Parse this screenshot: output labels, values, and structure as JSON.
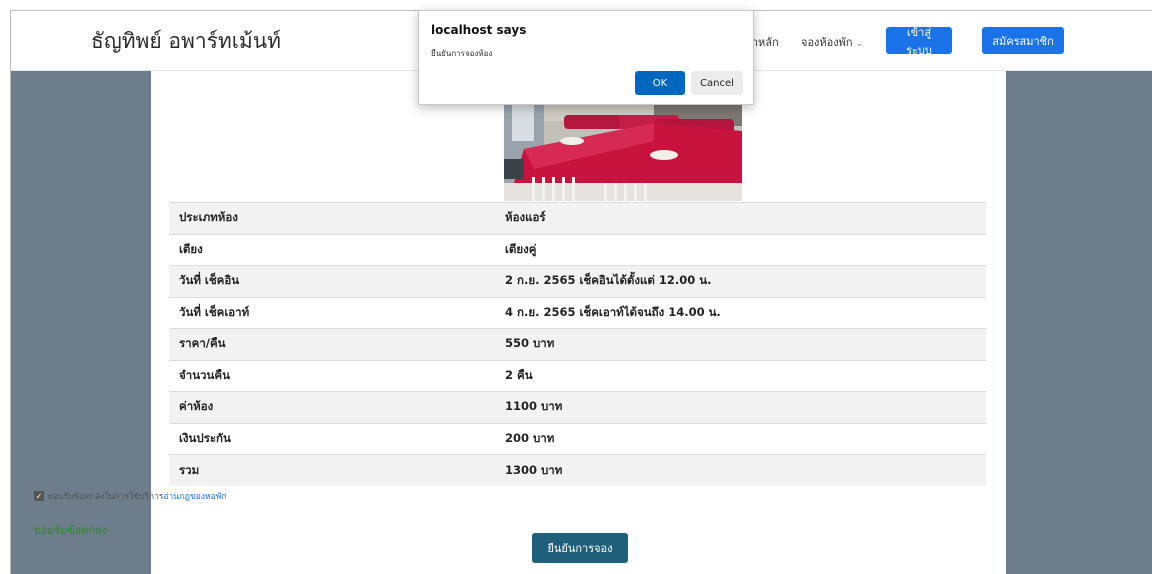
{
  "header": {
    "brand": "ธัญทิพย์ อพาร์ทเม้นท์",
    "nav_home": "หน้าหลัก",
    "nav_book": "จองห้องพัก",
    "login_label": "เข้าสู่ระบบ",
    "register_label": "สมัครสมาชิก"
  },
  "booking": {
    "rows": [
      {
        "label": "ประเภทห้อง",
        "value": "ห้องแอร์"
      },
      {
        "label": "เตียง",
        "value": "เตียงคู่"
      },
      {
        "label": "วันที่ เช็คอิน",
        "value": "2 ก.ย. 2565 เช็คอินได้ตั้งแต่ 12.00 น."
      },
      {
        "label": "วันที่ เช็คเอาท์",
        "value": "4 ก.ย. 2565 เช็คเอาท์ได้จนถึง 14.00 น."
      },
      {
        "label": "ราคา/คืน",
        "value": "550 บาท"
      },
      {
        "label": "จำนวนคืน",
        "value": "2 คืน"
      },
      {
        "label": "ค่าห้อง",
        "value": "1100 บาท"
      },
      {
        "label": "เงินประกัน",
        "value": "200 บาท"
      },
      {
        "label": "รวม",
        "value": "1300 บาท"
      }
    ],
    "agree_text": "ยอมรับข้อตกลงในการใช้บริการ",
    "rules_link": "อ่านกฎของหอพัก",
    "agree_status": "ยอมรับข้อตกลง",
    "confirm_label": "ยืนยันการจอง"
  },
  "dialog": {
    "title": "localhost says",
    "message": "ยืนยันการจองห้อง",
    "ok_label": "OK",
    "cancel_label": "Cancel"
  },
  "icons": {
    "chevron": "chevron-down-icon",
    "checkbox": "checkbox-checked-icon"
  },
  "colors": {
    "primary": "#1a73e8",
    "confirm": "#1f5f7a",
    "side_panel": "#6d7d8c",
    "agree_status": "#2e8b2e"
  }
}
